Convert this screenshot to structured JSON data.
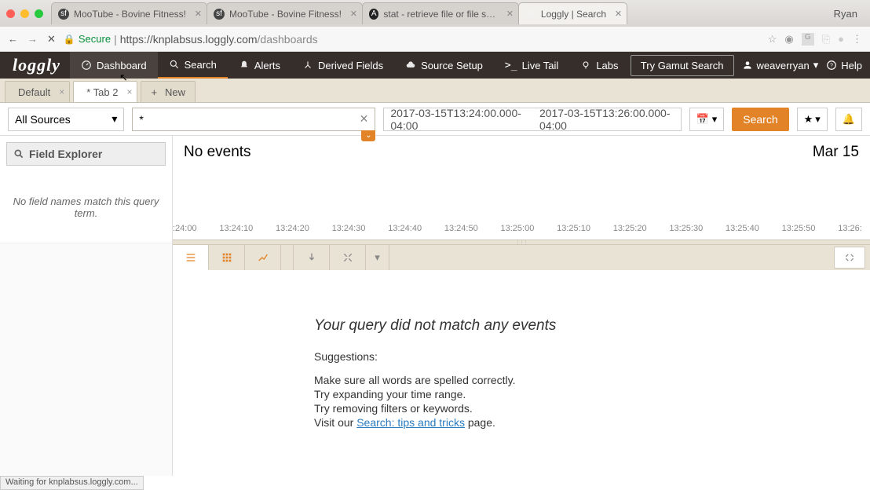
{
  "browser": {
    "profile": "Ryan",
    "tabs": [
      {
        "title": "MooTube - Bovine Fitness!",
        "favicon_bg": "#333",
        "favicon_text": "sf"
      },
      {
        "title": "MooTube - Bovine Fitness!",
        "favicon_bg": "#333",
        "favicon_text": "sf"
      },
      {
        "title": "stat - retrieve file or file system",
        "favicon_bg": "#333",
        "favicon_text": "A"
      },
      {
        "title": "Loggly | Search",
        "favicon_bg": "#fff",
        "favicon_text": "",
        "active": true
      }
    ],
    "secure_label": "Secure",
    "url_host": "https://knplabsus.loggly.com",
    "url_path": "/dashboards",
    "status_text": "Waiting for knplabsus.loggly.com..."
  },
  "nav": {
    "logo": "loggly",
    "items": [
      {
        "label": "Dashboard"
      },
      {
        "label": "Search"
      },
      {
        "label": "Alerts"
      },
      {
        "label": "Derived Fields"
      },
      {
        "label": "Source Setup"
      },
      {
        "label": "Live Tail"
      },
      {
        "label": "Labs"
      }
    ],
    "gamut_btn": "Try Gamut Search",
    "username": "weaverryan",
    "help": "Help"
  },
  "subtabs": {
    "default_label": "Default",
    "active_label": "* Tab 2",
    "new_label": "New"
  },
  "filter": {
    "source": "All Sources",
    "query": "*",
    "time_start": "2017-03-15T13:24:00.000-04:00",
    "time_end": "2017-03-15T13:26:00.000-04:00",
    "search_btn": "Search"
  },
  "left": {
    "field_explorer": "Field Explorer",
    "no_fields": "No field names match this query term."
  },
  "events": {
    "count_label": "No events",
    "date_label": "Mar 15",
    "ticks": [
      ":24:00",
      "13:24:10",
      "13:24:20",
      "13:24:30",
      "13:24:40",
      "13:24:50",
      "13:25:00",
      "13:25:10",
      "13:25:20",
      "13:25:30",
      "13:25:40",
      "13:25:50",
      "13:26:"
    ]
  },
  "noresults": {
    "heading": "Your query did not match any events",
    "suggestions_label": "Suggestions:",
    "line1": "Make sure all words are spelled correctly.",
    "line2": "Try expanding your time range.",
    "line3": "Try removing filters or keywords.",
    "line4_prefix": "Visit our ",
    "line4_link": "Search: tips and tricks",
    "line4_suffix": " page."
  }
}
